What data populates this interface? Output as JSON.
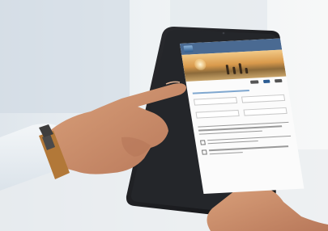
{
  "scene": {
    "description_colors": {
      "skin": "#c98d68",
      "watch_strap": "#b47a3c",
      "tablet_frame": "#1c1d20",
      "page_accent": "#2c5c92"
    }
  },
  "tablet_screen": {
    "header": {
      "title": "",
      "logo_icon": "logo-mark-icon"
    },
    "hero": {
      "icons": [
        "sun-icon",
        "family-silhouette-icon"
      ]
    },
    "partners": {
      "count": 3
    },
    "form": {
      "title": "",
      "fields": [
        {
          "label": ""
        },
        {
          "label": ""
        },
        {
          "label": ""
        },
        {
          "label": ""
        }
      ]
    }
  }
}
